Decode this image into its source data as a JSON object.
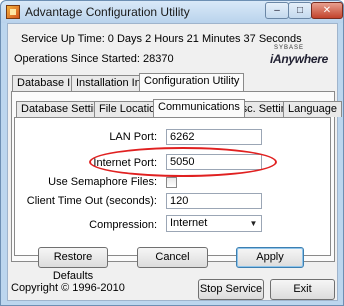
{
  "window": {
    "title": "Advantage Configuration Utility",
    "caption_buttons": {
      "minimize": "–",
      "maximize": "□",
      "close": "✕"
    }
  },
  "status": {
    "service_uptime": "Service Up Time:  0 Days 2 Hours 21 Minutes 37 Seconds",
    "operations": "Operations Since Started: 28370"
  },
  "logo": {
    "small": "SYBASE",
    "big": "iAnywhere"
  },
  "outer_tabs": [
    "Database Info",
    "Installation Info",
    "Configuration Utility"
  ],
  "outer_tab_active": "Configuration Utility",
  "inner_tabs": [
    "Database Settings",
    "File Locations",
    "Communications",
    "Misc. Settings",
    "Language"
  ],
  "inner_tab_active": "Communications",
  "communications": {
    "lan_port_label": "LAN Port:",
    "lan_port_value": "6262",
    "internet_port_label": "Internet Port:",
    "internet_port_value": "5050",
    "semaphore_label": "Use Semaphore Files:",
    "semaphore_checked": false,
    "timeout_label": "Client Time Out (seconds):",
    "timeout_value": "120",
    "compression_label": "Compression:",
    "compression_value": "Internet"
  },
  "buttons": {
    "restore": "Restore Defaults",
    "cancel": "Cancel",
    "apply": "Apply",
    "stop_service": "Stop Service",
    "exit": "Exit"
  },
  "footer": {
    "copyright": "Copyright © 1996-2010"
  },
  "annotation_color": "#e02020"
}
